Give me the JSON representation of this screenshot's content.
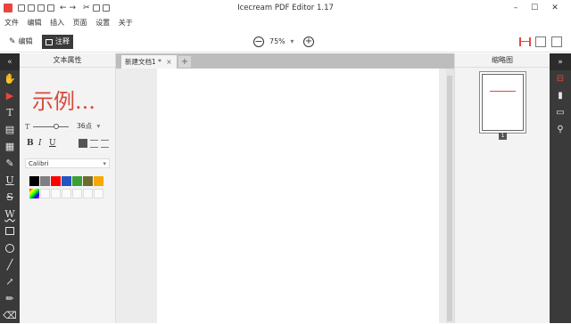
{
  "window": {
    "title": "Icecream PDF Editor 1.17",
    "controls": [
      "–",
      "☐",
      "✕"
    ]
  },
  "menu": {
    "items": [
      "文件",
      "编辑",
      "插入",
      "页面",
      "设置",
      "关于"
    ]
  },
  "toolbar": {
    "edit_label": "编辑",
    "annotate_label": "注释",
    "zoom_value": "75%"
  },
  "left_tools": [
    "»",
    "hand-icon",
    "pointer-icon",
    "text-tool-icon",
    "comment-icon",
    "note-icon",
    "pen-icon",
    "underline-icon",
    "strikethrough-icon",
    "wavy-underline-icon",
    "rectangle-icon",
    "ellipse-icon",
    "line-icon",
    "arrow-icon",
    "marker-icon",
    "eraser-icon"
  ],
  "props": {
    "header": "文本属性",
    "sample_text": "示例...",
    "font_size": "36点",
    "font_name": "Calibri",
    "colors": [
      "#000000",
      "#7f7f7f",
      "#ff0000",
      "#2254c4",
      "#3aa035",
      "#6e6a2e",
      "#f7a800"
    ],
    "accent": "#e8463c"
  },
  "document": {
    "tab_label": "新建文档1 *",
    "tab_close": "×",
    "new_tab": "+"
  },
  "thumbs": {
    "header": "缩略图",
    "page_number": "1"
  }
}
